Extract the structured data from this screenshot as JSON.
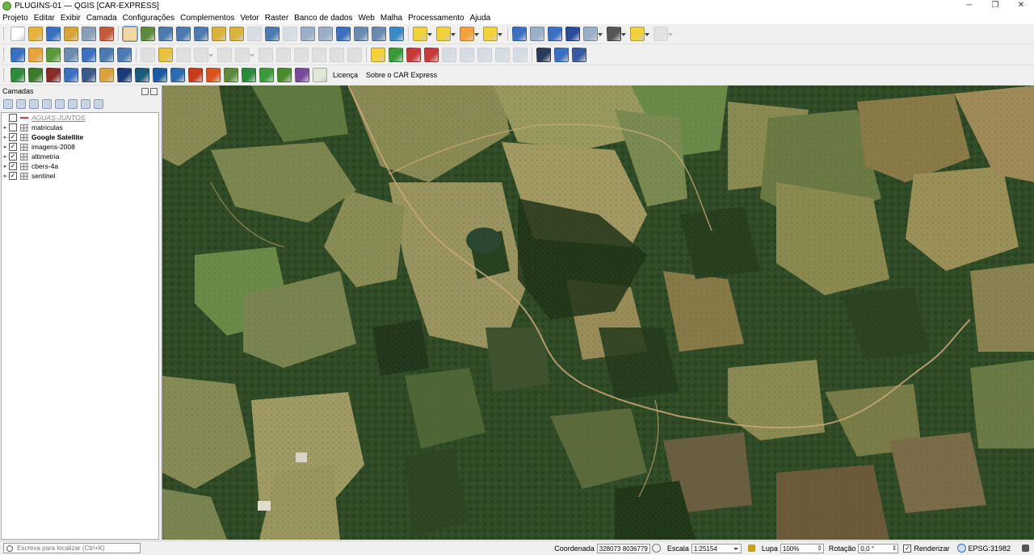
{
  "window": {
    "title": "PLUGINS-01 — QGIS [CAR-EXPRESS]"
  },
  "menu": [
    "Projeto",
    "Editar",
    "Exibir",
    "Camada",
    "Configurações",
    "Complementos",
    "Vetor",
    "Raster",
    "Banco de dados",
    "Web",
    "Malha",
    "Processamento",
    "Ajuda"
  ],
  "toolbar1": [
    {
      "icon": "new-project-icon",
      "color": "#ffffff"
    },
    {
      "icon": "open-project-icon",
      "color": "#e8b33a"
    },
    {
      "icon": "save-project-icon",
      "color": "#3a6fc1"
    },
    {
      "icon": "save-as-icon",
      "color": "#d9a33a"
    },
    {
      "icon": "print-layout-icon",
      "color": "#8aa0b8"
    },
    {
      "icon": "style-manager-icon",
      "color": "#c45a3a"
    },
    {
      "sep": true
    },
    {
      "icon": "pan-hand-icon",
      "color": "#f2d7a6",
      "active": true
    },
    {
      "icon": "pan-to-selection-icon",
      "color": "#5a8a3a"
    },
    {
      "icon": "zoom-in-icon",
      "color": "#4a7ab0"
    },
    {
      "icon": "zoom-out-icon",
      "color": "#4a7ab0"
    },
    {
      "icon": "zoom-full-icon",
      "color": "#4a7ab0"
    },
    {
      "icon": "zoom-selection-icon",
      "color": "#d9b33a"
    },
    {
      "icon": "zoom-layer-icon",
      "color": "#d9b33a"
    },
    {
      "icon": "zoom-native-icon",
      "color": "#9ab0c8",
      "off": true
    },
    {
      "icon": "zoom-last-icon",
      "color": "#4a7ab0"
    },
    {
      "icon": "zoom-next-icon",
      "color": "#9ab0c8",
      "off": true
    },
    {
      "icon": "new-map-view-icon",
      "color": "#9ab0c8"
    },
    {
      "icon": "new-3d-view-icon",
      "color": "#9ab0c8"
    },
    {
      "icon": "bookmark-new-icon",
      "color": "#3a6fc1"
    },
    {
      "icon": "show-bookmarks-icon",
      "color": "#6a8ab0"
    },
    {
      "icon": "temporal-controller-icon",
      "color": "#6a8ab0"
    },
    {
      "icon": "refresh-icon",
      "color": "#3a8ac8"
    },
    {
      "sep": true
    },
    {
      "icon": "select-features-icon",
      "color": "#f2d23a",
      "dd": true
    },
    {
      "icon": "select-by-value-icon",
      "color": "#f2d23a",
      "dd": true
    },
    {
      "icon": "deselect-all-icon",
      "color": "#f2a23a",
      "dd": true
    },
    {
      "icon": "select-by-expression-icon",
      "color": "#f2d23a",
      "dd": true
    },
    {
      "sep": true
    },
    {
      "icon": "identify-features-icon",
      "color": "#3a6fc1"
    },
    {
      "icon": "attribute-table-icon",
      "color": "#9ab0c8"
    },
    {
      "icon": "processing-gear-icon",
      "color": "#3a6fc1"
    },
    {
      "icon": "statistics-sigma-icon",
      "color": "#2a4a9a"
    },
    {
      "icon": "open-field-calculator-icon",
      "color": "#9ab0c8",
      "dd": true
    },
    {
      "icon": "measure-line-icon",
      "color": "#555555",
      "dd": true
    },
    {
      "icon": "map-tips-icon",
      "color": "#f2d23a",
      "dd": true
    },
    {
      "icon": "decorations-icon",
      "color": "#c0c0c0",
      "off": true,
      "dd": true
    }
  ],
  "toolbar2": [
    {
      "icon": "data-source-manager-icon",
      "color": "#3a6fc1"
    },
    {
      "icon": "add-geopackage-icon",
      "color": "#e8a33a"
    },
    {
      "icon": "add-vector-icon",
      "color": "#5a9a3a"
    },
    {
      "icon": "add-spatialite-icon",
      "color": "#6a8ab0"
    },
    {
      "icon": "add-postgis-icon",
      "color": "#3a6fc1"
    },
    {
      "icon": "add-wms-icon",
      "color": "#4a7ab0"
    },
    {
      "icon": "add-wfs-icon",
      "color": "#4a7ab0"
    },
    {
      "sep": true
    },
    {
      "icon": "pencil-edit-icon",
      "color": "#bbbbbb",
      "off": true
    },
    {
      "icon": "toggle-editing-icon",
      "color": "#e8c33a"
    },
    {
      "icon": "save-edits-icon",
      "color": "#bbbbbb",
      "off": true
    },
    {
      "icon": "digitize-line-icon",
      "color": "#bbbbbb",
      "off": true,
      "dd": true
    },
    {
      "icon": "add-vertex-icon",
      "color": "#bbbbbb",
      "off": true
    },
    {
      "icon": "vertex-tool-icon",
      "color": "#bbbbbb",
      "off": true,
      "dd": true
    },
    {
      "icon": "delete-selected-icon",
      "color": "#bbbbbb",
      "off": true
    },
    {
      "icon": "cut-features-icon",
      "color": "#bbbbbb",
      "off": true
    },
    {
      "icon": "copy-features-icon",
      "color": "#bbbbbb",
      "off": true
    },
    {
      "icon": "paste-features-icon",
      "color": "#bbbbbb",
      "off": true
    },
    {
      "icon": "undo-icon",
      "color": "#bbbbbb",
      "off": true
    },
    {
      "icon": "redo-icon",
      "color": "#bbbbbb",
      "off": true
    },
    {
      "sep": true
    },
    {
      "icon": "label-abc-icon",
      "color": "#f2d23a"
    },
    {
      "icon": "label-diagram-icon",
      "color": "#3a9a3a"
    },
    {
      "icon": "label-pin-icon",
      "color": "#c83a3a"
    },
    {
      "icon": "label-highlight-icon",
      "color": "#c83a3a"
    },
    {
      "icon": "label-move-icon",
      "color": "#9ab0c8",
      "off": true
    },
    {
      "icon": "label-rotate-icon",
      "color": "#9ab0c8",
      "off": true
    },
    {
      "icon": "label-change-icon",
      "color": "#9ab0c8",
      "off": true
    },
    {
      "icon": "label-show-hide-icon",
      "color": "#9ab0c8",
      "off": true
    },
    {
      "icon": "label-properties-icon",
      "color": "#9ab0c8",
      "off": true
    },
    {
      "sep": true
    },
    {
      "icon": "web-globe-plugin-icon",
      "color": "#2a3a5a"
    },
    {
      "icon": "python-console-icon",
      "color": "#3a6fc1"
    },
    {
      "icon": "help-icon",
      "color": "#3a5aa0"
    }
  ],
  "toolbar3": {
    "icons": [
      {
        "icon": "car-brazil-flag-icon",
        "color": "#2f8a3a"
      },
      {
        "icon": "car-leaf-icon",
        "color": "#3a7a2a"
      },
      {
        "icon": "car-book-icon",
        "color": "#8a2a2a"
      },
      {
        "icon": "car-settings-icon",
        "color": "#3a6fc1"
      },
      {
        "icon": "car-download-icon",
        "color": "#3a5a8a"
      },
      {
        "icon": "car-compass-icon",
        "color": "#d9a33a"
      },
      {
        "icon": "car-inpe-logo-icon",
        "color": "#1a3a7a"
      },
      {
        "icon": "car-globe-logo-icon",
        "color": "#1a5a7a"
      },
      {
        "icon": "car-search-logo-icon",
        "color": "#1a5aa0"
      },
      {
        "icon": "car-globe-blue-icon",
        "color": "#2a6ab0"
      },
      {
        "icon": "car-fire-icon",
        "color": "#c83a1a"
      },
      {
        "icon": "car-fire-alt-icon",
        "color": "#d9531a"
      },
      {
        "icon": "car-map-icon",
        "color": "#5a8a3a"
      },
      {
        "icon": "car-tree-icon",
        "color": "#2a8a3a"
      },
      {
        "icon": "car-tree-alt-icon",
        "color": "#3a9a3a"
      },
      {
        "icon": "car-tree-box-icon",
        "color": "#4a8a2a"
      },
      {
        "icon": "car-satellite-icon",
        "color": "#7a4a9a"
      },
      {
        "icon": "car-circle-icon",
        "color": "#e0e8d8"
      }
    ],
    "links": [
      "Licença",
      "Sobre o CAR Express"
    ]
  },
  "layers_panel": {
    "title": "Camadas",
    "tools": [
      "open-styling-icon",
      "add-group-icon",
      "manage-visibility-icon",
      "filter-legend-icon",
      "filter-expression-icon",
      "expand-all-icon",
      "collapse-all-icon",
      "remove-layer-icon"
    ],
    "layers": [
      {
        "name": "AGUAS-JUNTOS",
        "checked": false,
        "expandable": false,
        "style": "ital",
        "icon": "line"
      },
      {
        "name": "matriculas",
        "checked": false,
        "expandable": true,
        "style": "",
        "icon": "grid"
      },
      {
        "name": "Google Satellite",
        "checked": true,
        "expandable": true,
        "style": "bold",
        "icon": "grid"
      },
      {
        "name": "imagens-2008",
        "checked": true,
        "expandable": true,
        "style": "",
        "icon": "grid"
      },
      {
        "name": "altimetria",
        "checked": true,
        "expandable": true,
        "style": "",
        "icon": "grid"
      },
      {
        "name": "cbers-4a",
        "checked": true,
        "expandable": true,
        "style": "",
        "icon": "grid"
      },
      {
        "name": "sentinel",
        "checked": true,
        "expandable": true,
        "style": "",
        "icon": "grid"
      }
    ]
  },
  "statusbar": {
    "locator_placeholder": "Escreva para localizar (Ctrl+K)",
    "coord_label": "Coordenada",
    "coord_value": "328073  8036779",
    "scale_label": "Escala",
    "scale_value": "1:25154",
    "magnifier_label": "Lupa",
    "magnifier_value": "100%",
    "rotation_label": "Rotação",
    "rotation_value": "0,0 °",
    "render_label": "Renderizar",
    "crs_label": "EPSG:31982"
  }
}
